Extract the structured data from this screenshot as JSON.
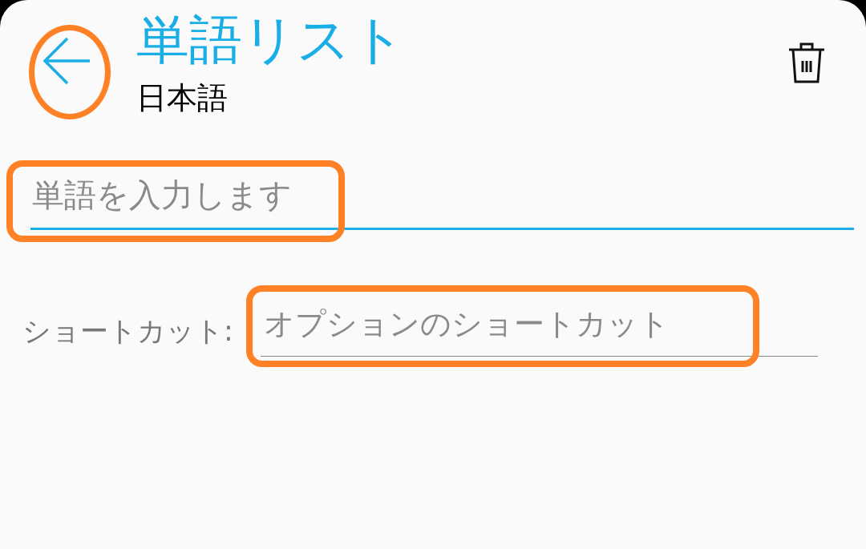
{
  "header": {
    "back": {
      "highlighted": true
    },
    "title": "単語リスト",
    "subtitle": "日本語"
  },
  "word_field": {
    "placeholder": "単語を入力します",
    "focused": true,
    "highlighted": true
  },
  "shortcut": {
    "label": "ショートカット:",
    "placeholder": "オプションのショートカット",
    "highlighted": true
  }
}
